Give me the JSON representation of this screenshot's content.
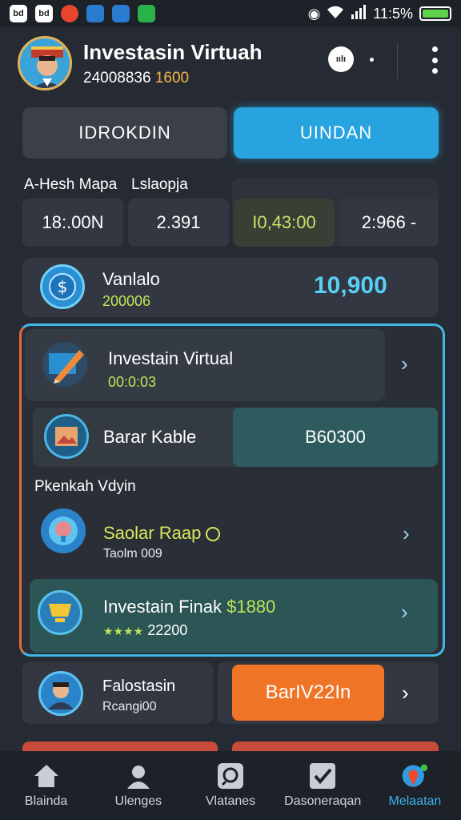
{
  "status_bar": {
    "apps": [
      "bd",
      "bd",
      "",
      "",
      ""
    ],
    "time": "11:5%"
  },
  "header": {
    "title": "Investasin Virtuah",
    "subtitle_num": "24008836",
    "subtitle_highlight": "1600",
    "chat_badge": "ıılı"
  },
  "tabs": [
    {
      "label": "IDROKDIN"
    },
    {
      "label": "UINDAN"
    }
  ],
  "stats": {
    "labels": [
      "A-Hesh Mapa",
      "Lslaopja"
    ],
    "values": [
      "18:.00N",
      "2.391",
      "I0,43:00",
      "2:966 -"
    ]
  },
  "balance": {
    "title": "Vanlalo",
    "sub": "200006",
    "amount": "10,900"
  },
  "featured": {
    "item1": {
      "title": "Investain Virtual",
      "sub": "00:0:03"
    },
    "item2": {
      "title": "Barar Kable",
      "value": "B60300"
    },
    "section_label": "Pkenkah Vdyin",
    "item3": {
      "title": "Saolar Raap",
      "sub": "Taolm 009"
    },
    "item4": {
      "title": "Investain Finak",
      "amount": "$1880",
      "sub_stars": "★★★★",
      "sub_value": "22200"
    }
  },
  "bottom_row": {
    "title": "Falostasin",
    "sub": "Rcangi00",
    "button": "BarIV22In"
  },
  "nav": [
    {
      "label": "Blainda",
      "icon": "home-icon"
    },
    {
      "label": "Ulenges",
      "icon": "profile-icon"
    },
    {
      "label": "Vlatanes",
      "icon": "search-icon"
    },
    {
      "label": "Dasoneraqan",
      "icon": "checkbox-icon"
    },
    {
      "label": "Melaatan",
      "icon": "map-pin-icon"
    }
  ],
  "colors": {
    "accent": "#27a3e0",
    "orange": "#f07426",
    "green_text": "#bde55a"
  }
}
